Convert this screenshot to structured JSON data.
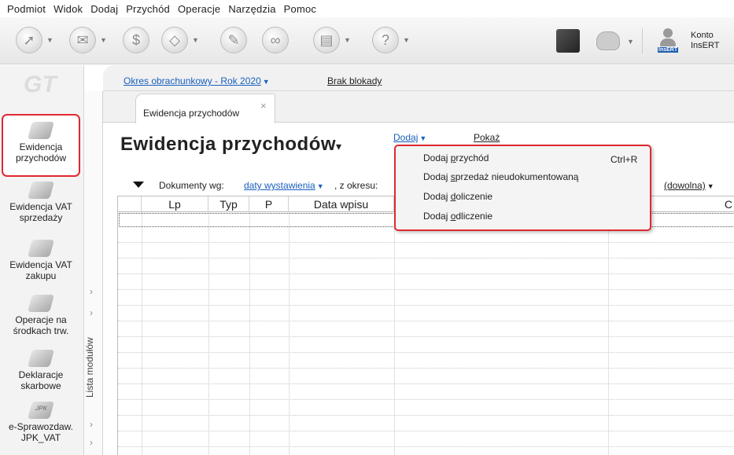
{
  "menubar": [
    "Podmiot",
    "Widok",
    "Dodaj",
    "Przychód",
    "Operacje",
    "Narzędzia",
    "Pomoc"
  ],
  "account": {
    "line1": "Konto",
    "line2": "InsERT",
    "badge": "InsERT"
  },
  "logo": "GT",
  "nav": [
    {
      "label": "Ewidencja przychodów",
      "icon": "ledger-icon",
      "active": true
    },
    {
      "label": "Ewidencja VAT sprzedaży",
      "icon": "coins-icon"
    },
    {
      "label": "Ewidencja VAT zakupu",
      "icon": "cart-icon"
    },
    {
      "label": "Operacje na środkach trw.",
      "icon": "machine-icon"
    },
    {
      "label": "Deklaracje skarbowe",
      "icon": "form-icon"
    },
    {
      "label": "e-Sprawozdaw. JPK_VAT",
      "icon": "jpk-icon",
      "badge": "JPK"
    }
  ],
  "module_strip_title": "Lista modułów",
  "period": {
    "label": "Okres obrachunkowy - Rok 2020",
    "lock": "Brak blokady"
  },
  "tab": {
    "label": "Ewidencja przychodów",
    "close": "×"
  },
  "page_title": "Ewidencja przychodów",
  "actions": {
    "add": "Dodaj",
    "show": "Pokaż"
  },
  "filter": {
    "label": "Dokumenty wg:",
    "value": "daty wystawienia",
    "range_label": ", z okresu:",
    "range_value": "(dowolna)"
  },
  "columns": [
    "Lp",
    "Typ",
    "P",
    "Data wpisu",
    "C"
  ],
  "menu": {
    "items": [
      {
        "pre": "Dodaj ",
        "accel": "p",
        "post": "rzychód",
        "shortcut": "Ctrl+R"
      },
      {
        "pre": "Dodaj ",
        "accel": "s",
        "post": "przedaż nieudokumentowaną"
      },
      {
        "pre": "Dodaj ",
        "accel": "d",
        "post": "oliczenie"
      },
      {
        "pre": "Dodaj ",
        "accel": "o",
        "post": "dliczenie"
      }
    ]
  },
  "colors": {
    "link": "#1a5fbf",
    "highlight": "#e0282f"
  }
}
